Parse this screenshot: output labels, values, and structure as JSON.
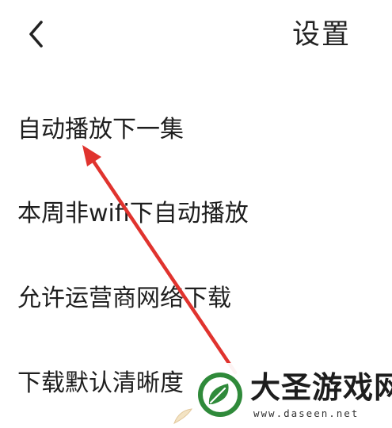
{
  "header": {
    "back_icon": "chevron-left-icon",
    "title": "设置"
  },
  "settings": {
    "items": [
      {
        "label": "自动播放下一集"
      },
      {
        "label": "本周非wifi下自动播放"
      },
      {
        "label": "允许运营商网络下载"
      },
      {
        "label": "下载默认清晰度"
      }
    ]
  },
  "annotation": {
    "arrow_color": "#e0332e",
    "arrow_icon": "red-arrow-pointer"
  },
  "watermark": {
    "name": "大圣游戏网",
    "url": "www.daseen.net",
    "badge_color": "#2f8a3a",
    "badge_icon": "leaf-logo-icon"
  }
}
